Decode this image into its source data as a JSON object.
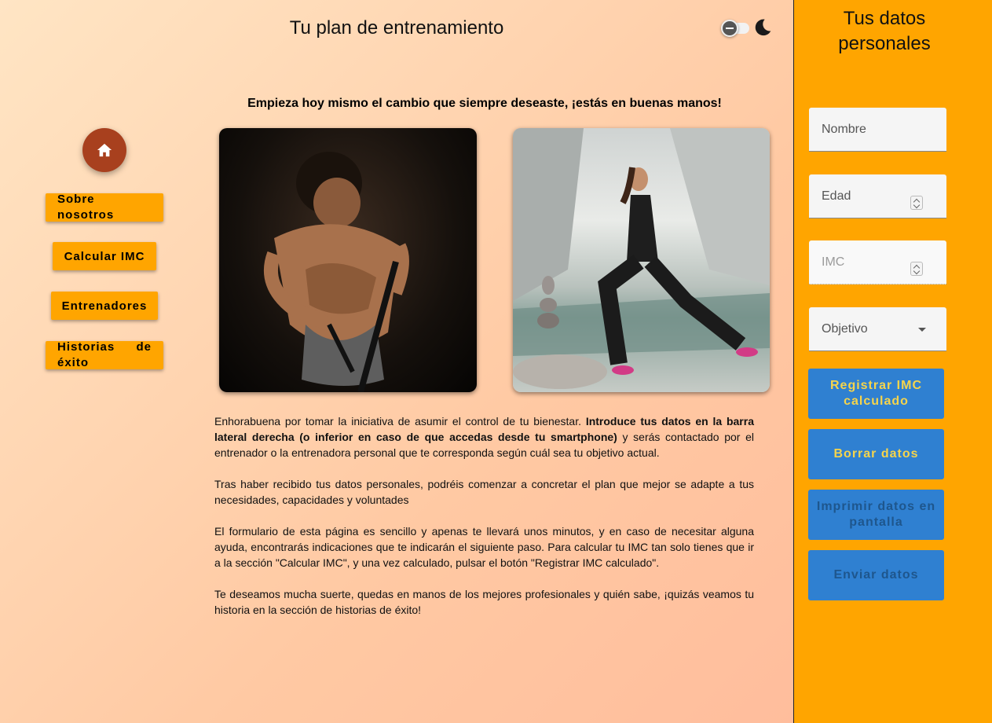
{
  "header": {
    "title": "Tu plan de entrenamiento"
  },
  "theme_toggle": {
    "toggle_icon": "toggle-switch-off",
    "mode_icon": "moon-icon"
  },
  "nav": {
    "home_icon": "home-icon",
    "items": [
      {
        "label": "Sobre nosotros"
      },
      {
        "label": "Calcular IMC"
      },
      {
        "label": "Entrenadores"
      },
      {
        "label": "Historias de éxito"
      }
    ]
  },
  "main": {
    "tagline": "Empieza hoy mismo el cambio que siempre deseaste, ¡estás en buenas manos!",
    "paragraphs": {
      "p1_start": "Enhorabuena por tomar la iniciativa de asumir el control de tu bienestar. ",
      "p1_bold": "Introduce tus datos en la barra lateral derecha (o inferior en caso de que accedas desde tu smartphone)",
      "p1_end": " y serás contactado por el entrenador o la entrenadora personal que te corresponda según cuál sea tu objetivo actual.",
      "p2": "Tras haber recibido tus datos personales, podréis comenzar a concretar el plan que mejor se adapte a tus necesidades, capacidades y voluntades",
      "p3": "El formulario de esta página es sencillo y apenas te llevará unos minutos, y en caso de necesitar alguna ayuda, encontrarás indicaciones que te indicarán el siguiente paso. Para calcular tu IMC tan solo tienes que ir a la sección \"Calcular IMC\", y una vez calculado, pulsar el botón \"Registrar IMC calculado\".",
      "p4": "Te deseamos mucha suerte, quedas en manos de los mejores profesionales y quién sabe, ¡quizás veamos tu historia en la sección de historias de éxito!"
    }
  },
  "sidebar": {
    "title_line1": "Tus datos",
    "title_line2": "personales",
    "fields": {
      "nombre_placeholder": "Nombre",
      "edad_placeholder": "Edad",
      "imc_placeholder": "IMC",
      "objetivo_label": "Objetivo"
    },
    "buttons": {
      "registrar": "Registrar IMC calculado",
      "borrar": "Borrar datos",
      "imprimir": "Imprimir datos en pantalla",
      "enviar": "Enviar datos"
    }
  },
  "colors": {
    "accent": "#ffa500",
    "home_button": "#a8401e",
    "sidebar_button": "#2f80d1",
    "button_text_active": "#f5d44c",
    "button_text_disabled": "#1e568d"
  }
}
